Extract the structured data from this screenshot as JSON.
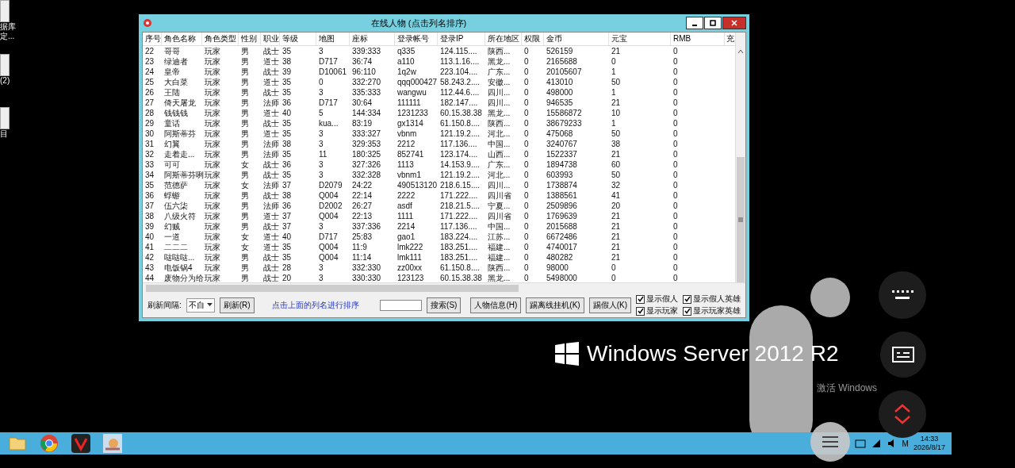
{
  "desktop_icons": [
    {
      "lines": [
        "据库",
        "定..."
      ]
    },
    {
      "lines": [
        "(2)"
      ]
    },
    {
      "lines": [
        "目"
      ]
    }
  ],
  "window": {
    "title": "在线人物 (点击列名排序)",
    "columns": [
      "序号",
      "角色名称",
      "角色类型",
      "性别",
      "职业",
      "等级",
      "地图",
      "座标",
      "登录帐号",
      "登录IP",
      "所在地区",
      "权限",
      "金币",
      "元宝",
      "RMB",
      "充"
    ],
    "rows": [
      [
        "22",
        "哥哥",
        "玩家",
        "男",
        "战士",
        "35",
        "3",
        "339:333",
        "q335",
        "124.115....",
        "陕西...",
        "0",
        "526159",
        "21",
        "0"
      ],
      [
        "23",
        "绿迪者",
        "玩家",
        "男",
        "道士",
        "38",
        "D717",
        "36:74",
        "a110",
        "113.1.16....",
        "黑龙...",
        "0",
        "2165688",
        "0",
        "0"
      ],
      [
        "24",
        "皇帝",
        "玩家",
        "男",
        "战士",
        "39",
        "D10061",
        "96:110",
        "1q2w",
        "223.104....",
        "广东...",
        "0",
        "20105607",
        "1",
        "0"
      ],
      [
        "25",
        "大白菜",
        "玩家",
        "男",
        "道士",
        "35",
        "0",
        "332:270",
        "qqq000427",
        "58.243.2....",
        "安徽...",
        "0",
        "413010",
        "50",
        "0"
      ],
      [
        "26",
        "王陆",
        "玩家",
        "男",
        "战士",
        "35",
        "3",
        "335:333",
        "wangwu",
        "112.44.6....",
        "四川...",
        "0",
        "498000",
        "1",
        "0"
      ],
      [
        "27",
        "倚天屠龙",
        "玩家",
        "男",
        "法师",
        "36",
        "D717",
        "30:64",
        "111111",
        "182.147....",
        "四川...",
        "0",
        "946535",
        "21",
        "0"
      ],
      [
        "28",
        "钱钱钱",
        "玩家",
        "男",
        "道士",
        "40",
        "5",
        "144:334",
        "1231233",
        "60.15.38.38",
        "黑龙...",
        "0",
        "15586872",
        "10",
        "0"
      ],
      [
        "29",
        "童话",
        "玩家",
        "男",
        "战士",
        "35",
        "kua...",
        "83:19",
        "gx1314",
        "61.150.8....",
        "陕西...",
        "0",
        "38679233",
        "1",
        "0"
      ],
      [
        "30",
        "阿斯蒂芬",
        "玩家",
        "男",
        "道士",
        "35",
        "3",
        "333:327",
        "vbnm",
        "121.19.2....",
        "河北...",
        "0",
        "475068",
        "50",
        "0"
      ],
      [
        "31",
        "幻翼",
        "玩家",
        "男",
        "法师",
        "38",
        "3",
        "329:353",
        "2212",
        "117.136....",
        "中国...",
        "0",
        "3240767",
        "38",
        "0"
      ],
      [
        "32",
        "走着走...",
        "玩家",
        "男",
        "法师",
        "35",
        "11",
        "180:325",
        "852741",
        "123.174....",
        "山西...",
        "0",
        "1522337",
        "21",
        "0"
      ],
      [
        "33",
        "可可",
        "玩家",
        "女",
        "战士",
        "36",
        "3",
        "327:326",
        "1113",
        "14.153.9....",
        "广东...",
        "0",
        "1894738",
        "60",
        "0"
      ],
      [
        "34",
        "阿斯蒂芬咧",
        "玩家",
        "男",
        "战士",
        "35",
        "3",
        "332:328",
        "vbnm1",
        "121.19.2....",
        "河北...",
        "0",
        "603993",
        "50",
        "0"
      ],
      [
        "35",
        "范德萨",
        "玩家",
        "女",
        "法师",
        "37",
        "D2079",
        "24:22",
        "490513120",
        "218.6.15....",
        "四川...",
        "0",
        "1738874",
        "32",
        "0"
      ],
      [
        "36",
        "蜉蝣",
        "玩家",
        "男",
        "战士",
        "38",
        "Q004",
        "22:14",
        "2222",
        "171.222....",
        "四川省",
        "0",
        "1388561",
        "41",
        "0"
      ],
      [
        "37",
        "伍六柒",
        "玩家",
        "男",
        "法师",
        "36",
        "D2002",
        "26:27",
        "asdf",
        "218.21.5....",
        "宁夏...",
        "0",
        "2509896",
        "20",
        "0"
      ],
      [
        "38",
        "八级火符",
        "玩家",
        "男",
        "道士",
        "37",
        "Q004",
        "22:13",
        "1111",
        "171.222....",
        "四川省",
        "0",
        "1769639",
        "21",
        "0"
      ],
      [
        "39",
        "幻贼",
        "玩家",
        "男",
        "战士",
        "37",
        "3",
        "337:336",
        "2214",
        "117.136....",
        "中国...",
        "0",
        "2015688",
        "21",
        "0"
      ],
      [
        "40",
        "一道",
        "玩家",
        "女",
        "道士",
        "40",
        "D717",
        "25:83",
        "gao1",
        "183.224....",
        "江苏...",
        "0",
        "6672486",
        "21",
        "0"
      ],
      [
        "41",
        "二二二",
        "玩家",
        "女",
        "道士",
        "35",
        "Q004",
        "11:9",
        "lmk222",
        "183.251....",
        "福建...",
        "0",
        "4740017",
        "21",
        "0"
      ],
      [
        "42",
        "哒哒哒...",
        "玩家",
        "男",
        "战士",
        "35",
        "Q004",
        "11:14",
        "lmk111",
        "183.251....",
        "福建...",
        "0",
        "480282",
        "21",
        "0"
      ],
      [
        "43",
        "电饭锅4",
        "玩家",
        "男",
        "战士",
        "28",
        "3",
        "332:330",
        "zz00xx",
        "61.150.8....",
        "陕西...",
        "0",
        "98000",
        "0",
        "0"
      ],
      [
        "44",
        "废物分为给",
        "玩家",
        "男",
        "战士",
        "20",
        "3",
        "330:330",
        "123123",
        "60.15.38.38",
        "黑龙...",
        "0",
        "5498000",
        "0",
        "0"
      ]
    ],
    "footer": {
      "refresh_label": "刷新间隔:",
      "refresh_select": "不自",
      "refresh_button": "刷新(R)",
      "hint": "点击上面的列名进行排序",
      "search_button": "搜索(S)",
      "buttons": [
        "人物信息(H)",
        "踢离线挂机(K)",
        "踢假人(K)"
      ],
      "checkboxes": [
        {
          "label": "显示假人",
          "checked": true
        },
        {
          "label": "显示玩家",
          "checked": true
        },
        {
          "label": "显示假人英雄",
          "checked": true
        },
        {
          "label": "显示玩家英雄",
          "checked": true
        }
      ]
    }
  },
  "server_logo": "Windows Server 2012 R2",
  "activation": "激活 Windows",
  "taskbar": {
    "tray_letter": "M",
    "time": "14:33",
    "date": "2026/8/17"
  }
}
